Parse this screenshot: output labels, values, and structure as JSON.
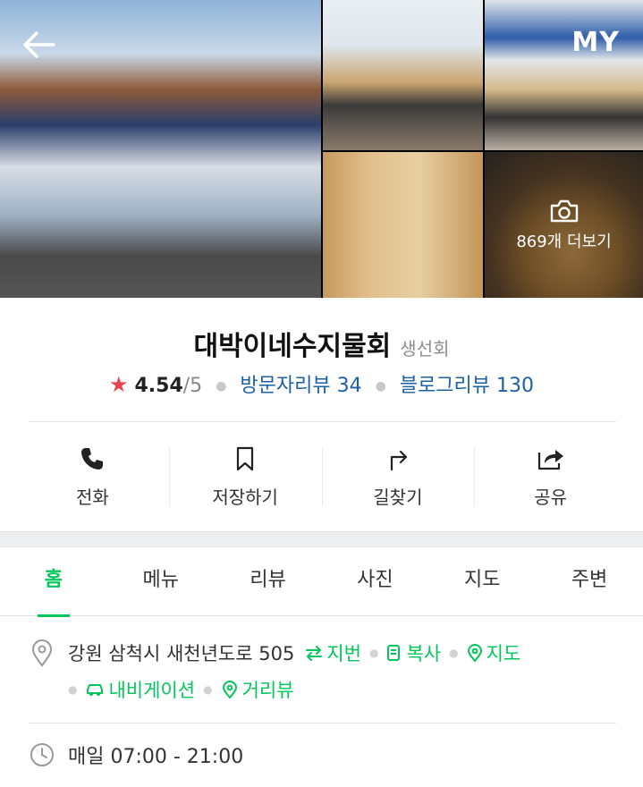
{
  "header": {
    "back_icon": "arrow-left-icon",
    "my_label": "MY"
  },
  "gallery": {
    "more_photos_label": "869개 더보기",
    "camera_icon": "camera-icon"
  },
  "place": {
    "name": "대박이네수지물회",
    "category": "생선회",
    "rating": "4.54",
    "rating_max": "/5",
    "visitor_reviews": "방문자리뷰 34",
    "blog_reviews": "블로그리뷰 130"
  },
  "actions": [
    {
      "label": "전화",
      "icon": "phone-icon"
    },
    {
      "label": "저장하기",
      "icon": "bookmark-icon"
    },
    {
      "label": "길찾기",
      "icon": "directions-icon"
    },
    {
      "label": "공유",
      "icon": "share-icon"
    }
  ],
  "tabs": [
    "홈",
    "메뉴",
    "리뷰",
    "사진",
    "지도",
    "주변"
  ],
  "active_tab": "홈",
  "address": {
    "text": "강원 삼척시 새천년도로 505",
    "links": [
      "지번",
      "복사",
      "지도",
      "내비게이션",
      "거리뷰"
    ]
  },
  "hours": "매일 07:00 - 21:00",
  "colors": {
    "accent": "#03c75a",
    "link": "#1d60a6",
    "star": "#e8464c"
  }
}
